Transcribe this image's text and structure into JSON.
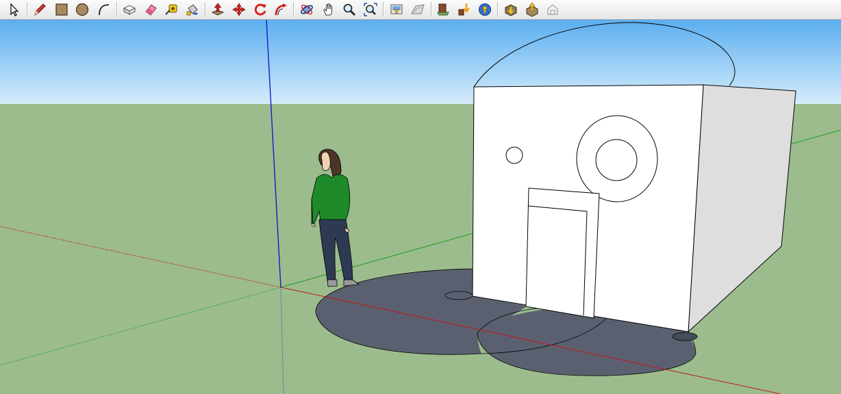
{
  "toolbar": {
    "tools": [
      {
        "name": "select-tool",
        "icon": "arrow-icon"
      },
      {
        "name": "pencil-tool",
        "icon": "pencil-icon"
      },
      {
        "name": "rectangle-tool",
        "icon": "rectangle-icon"
      },
      {
        "name": "circle-tool",
        "icon": "circle-icon"
      },
      {
        "name": "arc-tool",
        "icon": "arc-icon"
      },
      {
        "name": "make-component-tool",
        "icon": "component-icon"
      },
      {
        "name": "eraser-tool",
        "icon": "eraser-icon"
      },
      {
        "name": "tape-measure-tool",
        "icon": "tape-measure-icon"
      },
      {
        "name": "paint-bucket-tool",
        "icon": "paint-bucket-icon"
      },
      {
        "name": "push-pull-tool",
        "icon": "push-pull-icon"
      },
      {
        "name": "move-tool",
        "icon": "move-icon"
      },
      {
        "name": "rotate-tool",
        "icon": "rotate-icon"
      },
      {
        "name": "follow-me-tool",
        "icon": "follow-me-icon"
      },
      {
        "name": "orbit-tool",
        "icon": "orbit-icon"
      },
      {
        "name": "pan-tool",
        "icon": "hand-icon"
      },
      {
        "name": "zoom-tool",
        "icon": "magnifier-icon"
      },
      {
        "name": "zoom-extents-tool",
        "icon": "zoom-extents-icon"
      },
      {
        "name": "get-current-view-tool",
        "icon": "current-view-icon"
      },
      {
        "name": "toggle-terrain-tool",
        "icon": "terrain-icon"
      },
      {
        "name": "place-model-tool",
        "icon": "place-model-icon"
      },
      {
        "name": "get-models-tool",
        "icon": "get-models-icon"
      },
      {
        "name": "share-model-tool",
        "icon": "share-model-icon"
      },
      {
        "name": "extension-warehouse-tool",
        "icon": "warehouse-icon"
      },
      {
        "name": "share-component-tool",
        "icon": "share-component-icon"
      },
      {
        "name": "dynamic-component-tool",
        "icon": "dynamic-component-icon"
      }
    ]
  },
  "colors": {
    "sky_top": "#5aaef0",
    "sky_bottom": "#d6ecfb",
    "ground": "#9cbc8e",
    "shadow": "#5b6070",
    "building_front": "#ffffff",
    "building_side": "#dedede",
    "axis_red": "#c01818",
    "axis_green": "#1c9e1c",
    "axis_blue": "#1818c8",
    "shirt": "#1e8a2a",
    "jeans": "#2e3a52",
    "hair": "#4a3528"
  }
}
